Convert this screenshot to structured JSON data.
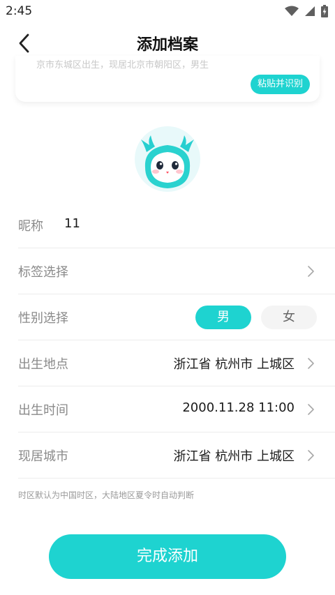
{
  "status_bar": {
    "time": "2:45",
    "icons": [
      "wifi-icon",
      "signal-icon",
      "battery-charging-icon"
    ]
  },
  "header": {
    "title": "添加档案",
    "back_icon": "chevron-left-icon"
  },
  "paste_card": {
    "hint": "京市东城区出生，现居北京市朝阳区，男生",
    "button_label": "粘贴并识别"
  },
  "avatar": {
    "icon": "cartoon-creature-avatar"
  },
  "form": {
    "nickname": {
      "label": "昵称",
      "value": "11"
    },
    "tags": {
      "label": "标签选择"
    },
    "gender": {
      "label": "性别选择",
      "male": "男",
      "female": "女",
      "selected": "男"
    },
    "birthplace": {
      "label": "出生地点",
      "value": "浙江省 杭州市 上城区"
    },
    "birthtime": {
      "label": "出生时间",
      "value": "2000.11.28 11:00"
    },
    "residence": {
      "label": "现居城市",
      "value": "浙江省 杭州市 上城区"
    }
  },
  "note": "时区默认为中国时区，大陆地区夏令时自动判断",
  "submit_label": "完成添加",
  "colors": {
    "accent": "#1ed3d0",
    "label": "#8a8a8a",
    "divider": "#ececec"
  }
}
